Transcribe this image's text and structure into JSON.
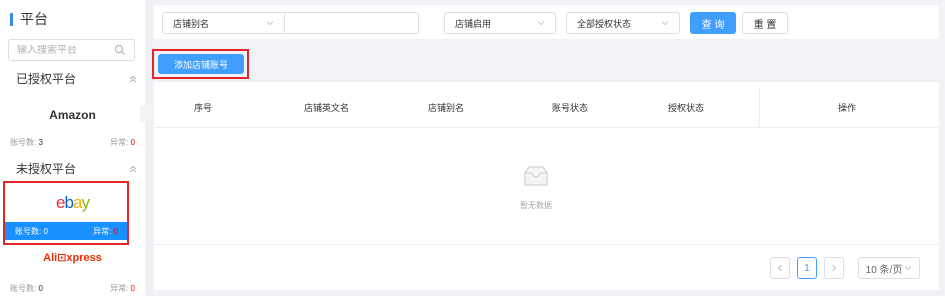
{
  "sidebar": {
    "title": "平台",
    "search_placeholder": "输入搜索平台",
    "authorized_label": "已授权平台",
    "unauthorized_label": "未授权平台",
    "platforms": [
      {
        "name": "Amazon",
        "count_label": "账号数:",
        "count": "3",
        "error_label": "异常:",
        "error": "0"
      },
      {
        "name": "ebay",
        "count_label": "账号数:",
        "count": "0",
        "error_label": "异常:",
        "error": "0",
        "selected": true
      },
      {
        "name": "Ali⊡xpress",
        "count_label": "账号数:",
        "count": "0",
        "error_label": "异常:",
        "error": "0"
      }
    ]
  },
  "filters": {
    "alias_select": "店铺别名",
    "alias_value": "",
    "enabled_select": "店铺启用",
    "auth_select": "全部授权状态",
    "search_label": "查 询",
    "reset_label": "重 置"
  },
  "toolbar": {
    "add_label": "添加店铺账号"
  },
  "table": {
    "columns": [
      "序号",
      "店铺英文名",
      "店铺别名",
      "账号状态",
      "授权状态",
      "操作"
    ],
    "empty_text": "暂无数据"
  },
  "pagination": {
    "current_page": "1",
    "page_size": "10 条/页"
  },
  "colors": {
    "accent": "#409eff",
    "highlight_frame": "#e4262b",
    "error": "#ee0000"
  }
}
